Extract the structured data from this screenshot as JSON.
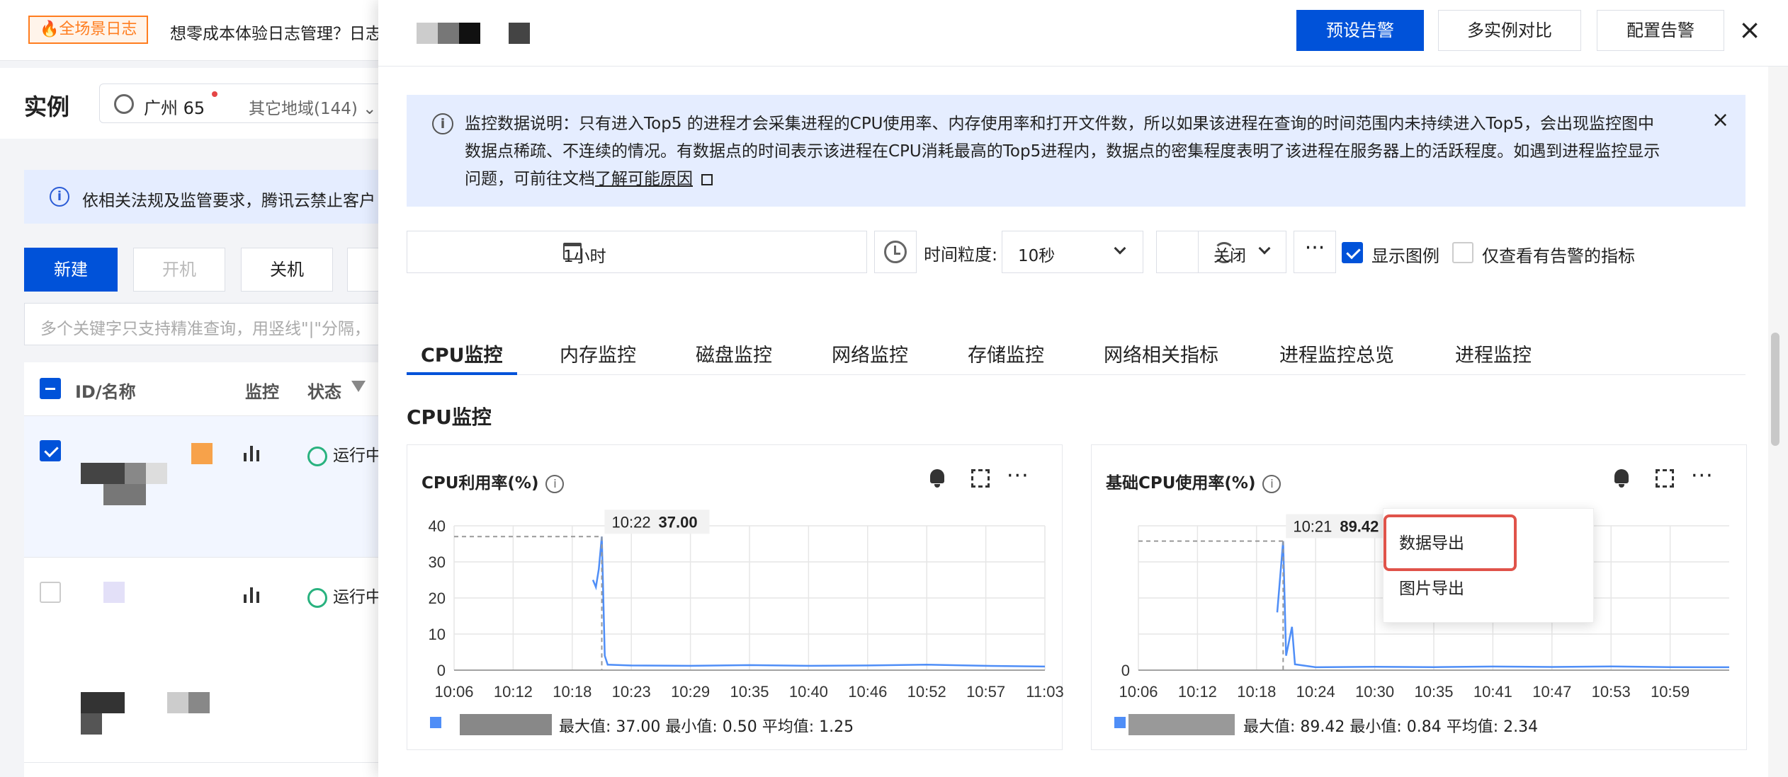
{
  "bg": {
    "promo_badge": "🔥全场景日志",
    "promo_text": "想零成本体验日志管理？日志",
    "title": "实例",
    "region": "广州 65",
    "other_region": "其它地域(144) ⌄",
    "notice": "依相关法规及监管要求，腾讯云禁止客户",
    "btn_new": "新建",
    "btn_on": "开机",
    "btn_off": "关机",
    "search_placeholder": "多个关键字只支持精准查询，用竖线\"|\"分隔，",
    "col_id": "ID/名称",
    "col_monitor": "监控",
    "col_status": "状态",
    "status_running": "运行中"
  },
  "drawer": {
    "buttons": {
      "preset_alarm": "预设告警",
      "compare": "多实例对比",
      "config_alarm": "配置告警"
    },
    "info": {
      "text": "监控数据说明：只有进入Top5 的进程才会采集进程的CPU使用率、内存使用率和打开文件数，所以如果该进程在查询的时间范围内未持续进入Top5，会出现监控图中数据点稀疏、不连续的情况。有数据点的时间表示该进程在CPU消耗最高的Top5进程内，数据点的密集程度表明了该进程在服务器上的活跃程度。如遇到进程监控显示问题，可前往文档",
      "link": "了解可能原因"
    },
    "toolbar": {
      "range": "1小时",
      "granularity_label": "时间粒度:",
      "granularity": "10秒",
      "refresh": "关闭",
      "dots": "···",
      "show_legend": "显示图例",
      "alarm_only": "仅查看有告警的指标"
    },
    "tabs": [
      "CPU监控",
      "内存监控",
      "磁盘监控",
      "网络监控",
      "存储监控",
      "网络相关指标",
      "进程监控总览",
      "进程监控"
    ],
    "section_title": "CPU监控",
    "menu": {
      "export_data": "数据导出",
      "export_image": "图片导出"
    }
  },
  "chart_data": [
    {
      "type": "line",
      "title": "CPU利用率(%)",
      "x_ticks": [
        "10:06",
        "10:12",
        "10:18",
        "10:23",
        "10:29",
        "10:35",
        "10:40",
        "10:46",
        "10:52",
        "10:57",
        "11:03"
      ],
      "y_ticks": [
        "0",
        "10",
        "20",
        "30",
        "40"
      ],
      "ylim": [
        0,
        40
      ],
      "tooltip_time": "10:22",
      "tooltip_value": "37.00",
      "series": [
        {
          "color": "#4f8ef7",
          "points": [
            [
              0.235,
              25
            ],
            [
              0.24,
              23
            ],
            [
              0.245,
              28
            ],
            [
              0.25,
              37
            ],
            [
              0.255,
              4
            ],
            [
              0.26,
              1.5
            ],
            [
              0.3,
              1.3
            ],
            [
              0.4,
              1.2
            ],
            [
              0.5,
              1.4
            ],
            [
              0.6,
              1.2
            ],
            [
              0.7,
              1.3
            ],
            [
              0.8,
              1.5
            ],
            [
              0.9,
              1.2
            ],
            [
              1.0,
              1.0
            ]
          ]
        }
      ],
      "stats": "最大值: 37.00 最小值: 0.50 平均值: 1.25"
    },
    {
      "type": "line",
      "title": "基础CPU使用率(%)",
      "x_ticks": [
        "10:06",
        "10:12",
        "10:18",
        "10:24",
        "10:30",
        "10:35",
        "10:41",
        "10:47",
        "10:53",
        "10:59"
      ],
      "y_ticks": [
        "0"
      ],
      "ylim": [
        0,
        100
      ],
      "tooltip_time": "10:21",
      "tooltip_value": "89.42",
      "series": [
        {
          "color": "#4f8ef7",
          "points": [
            [
              0.235,
              40
            ],
            [
              0.245,
              89.42
            ],
            [
              0.25,
              10
            ],
            [
              0.26,
              30
            ],
            [
              0.265,
              4
            ],
            [
              0.3,
              2
            ],
            [
              0.4,
              2.3
            ],
            [
              0.5,
              2.1
            ],
            [
              0.6,
              2.5
            ],
            [
              0.7,
              2.2
            ],
            [
              0.8,
              2.6
            ],
            [
              0.9,
              2.1
            ],
            [
              1.0,
              2.0
            ]
          ]
        }
      ],
      "stats": "最大值: 89.42 最小值: 0.84 平均值: 2.34"
    }
  ]
}
